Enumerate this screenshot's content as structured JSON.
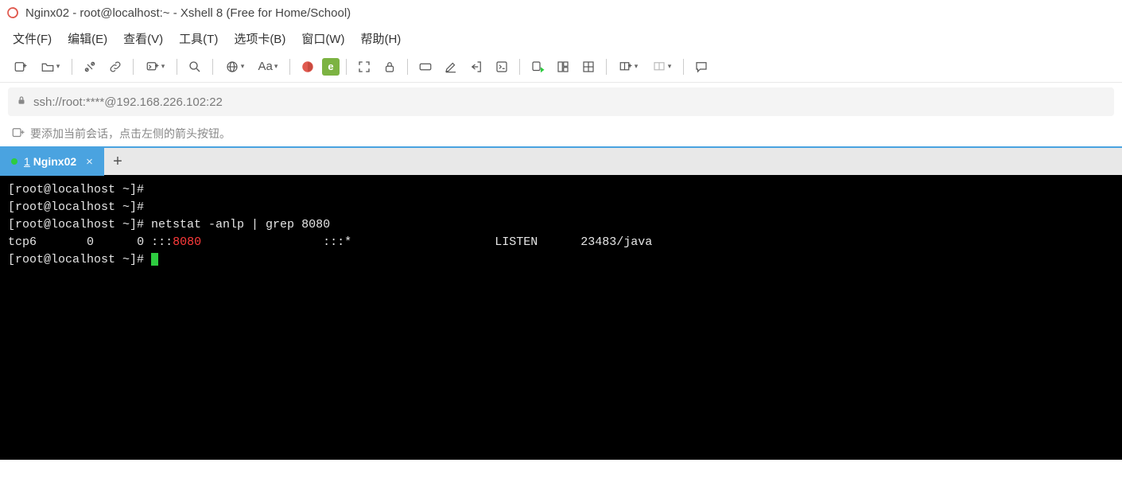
{
  "title": "Nginx02 - root@localhost:~ - Xshell 8 (Free for Home/School)",
  "menu": {
    "file": "文件(F)",
    "edit": "编辑(E)",
    "view": "查看(V)",
    "tools": "工具(T)",
    "options": "选项卡(B)",
    "window": "窗口(W)",
    "help": "帮助(H)"
  },
  "toolbar": {
    "font_label": "Aa"
  },
  "address_bar": "ssh://root:****@192.168.226.102:22",
  "hint": "要添加当前会话，点击左侧的箭头按钮。",
  "tabs": [
    {
      "index": "1",
      "label": "Nginx02"
    }
  ],
  "terminal": {
    "lines": [
      {
        "prompt": "[root@localhost ~]#",
        "cmd": ""
      },
      {
        "prompt": "[root@localhost ~]#",
        "cmd": ""
      },
      {
        "prompt": "[root@localhost ~]#",
        "cmd": " netstat -anlp | grep 8080"
      }
    ],
    "netstat": {
      "proto": "tcp6",
      "recvq": "0",
      "sendq": "0",
      "local_prefix": ":::",
      "local_port": "8080",
      "foreign": ":::*",
      "state": "LISTEN",
      "pid_prog": "23483/java"
    },
    "final_prompt": "[root@localhost ~]# "
  }
}
